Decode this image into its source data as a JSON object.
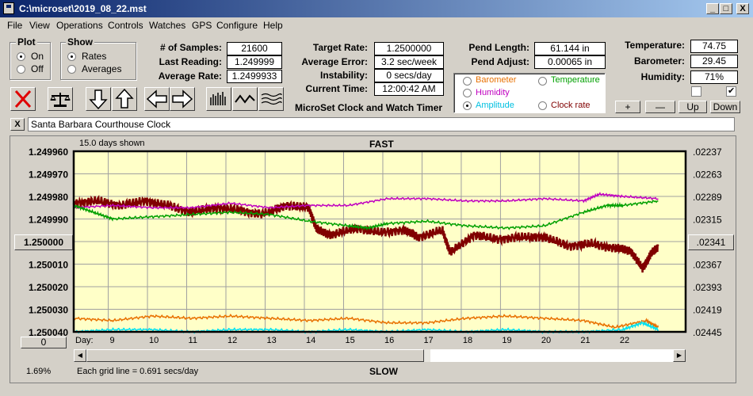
{
  "window": {
    "title": "C:\\microset\\2019_08_22.mst",
    "min": "_",
    "max": "□",
    "close": "X"
  },
  "menu": [
    "File",
    "View",
    "Operations",
    "Controls",
    "Watches",
    "GPS",
    "Configure",
    "Help"
  ],
  "plot_group": {
    "title": "Plot",
    "on": "On",
    "off": "Off",
    "selected": "On"
  },
  "show_group": {
    "title": "Show",
    "rates": "Rates",
    "averages": "Averages",
    "selected": "Rates"
  },
  "stats": {
    "samples_label": "# of Samples:",
    "samples": "21600",
    "last_label": "Last Reading:",
    "last": "1.249999",
    "avg_label": "Average Rate:",
    "avg": "1.2499933",
    "target_label": "Target Rate:",
    "target": "1.2500000",
    "err_label": "Average Error:",
    "err": "3.2 sec/week",
    "inst_label": "Instability:",
    "inst": "0 secs/day",
    "time_label": "Current Time:",
    "time": "12:00:42 AM",
    "pendlen_label": "Pend Length:",
    "pendlen": "61.144 in",
    "pendadj_label": "Pend Adjust:",
    "pendadj": "0.00065 in",
    "temp_label": "Temperature:",
    "temp": "74.75",
    "baro_label": "Barometer:",
    "baro": "29.45",
    "hum_label": "Humidity:",
    "hum": "71%"
  },
  "app_title": "MicroSet Clock and Watch Timer",
  "overlay": {
    "items": [
      {
        "label": "Barometer",
        "color": "#e87000"
      },
      {
        "label": "Temperature",
        "color": "#00a000"
      },
      {
        "label": "Humidity",
        "color": "#c000c0"
      },
      {
        "label": "Amplitude",
        "color": "#00c0e0"
      },
      {
        "label": "Clock rate",
        "color": "#800000"
      }
    ],
    "selected": "Amplitude"
  },
  "right_buttons": {
    "plus": "+",
    "minus": "—",
    "up": "Up",
    "down": "Down"
  },
  "clock_name": "Santa Barbara Courthouse Clock",
  "clock_close": "X",
  "chart_meta": {
    "days_shown": "15.0 days shown",
    "fast": "FAST",
    "slow": "SLOW",
    "grid_note": "Each grid line = 0.691 secs/day",
    "day_label": "Day:",
    "pct": "1.69%",
    "zero_btn": "0"
  },
  "chart_data": {
    "type": "line",
    "x_ticks": [
      "9",
      "10",
      "11",
      "12",
      "13",
      "14",
      "15",
      "16",
      "17",
      "18",
      "19",
      "20",
      "21",
      "22"
    ],
    "left_axis": [
      "1.249960",
      "1.249970",
      "1.249980",
      "1.249990",
      "1.250000",
      "1.250010",
      "1.250020",
      "1.250030",
      "1.250040"
    ],
    "right_axis": [
      ".02237",
      ".02263",
      ".02289",
      ".02315",
      ".02341",
      ".02367",
      ".02393",
      ".02419",
      ".02445"
    ],
    "left_center_button": "1.250000",
    "right_center_button": ".02341",
    "ylim": [
      1.24996,
      1.25004
    ],
    "xlim": [
      8.0,
      23.6
    ],
    "series": [
      {
        "name": "Clock rate",
        "color": "#800000",
        "x": [
          8.0,
          8.6,
          9.2,
          9.8,
          10.4,
          11.0,
          11.6,
          12.2,
          12.8,
          13.4,
          14.0,
          14.2,
          14.6,
          15.2,
          15.8,
          16.4,
          16.8,
          17.4,
          17.6,
          18.2,
          18.8,
          19.4,
          20.0,
          20.6,
          21.2,
          21.8,
          22.2,
          22.5,
          22.7,
          22.9
        ],
        "y": [
          1.249983,
          1.249982,
          1.249984,
          1.249982,
          1.249984,
          1.249987,
          1.249985,
          1.249986,
          1.249988,
          1.249984,
          1.249985,
          1.249995,
          1.249997,
          1.249994,
          1.249996,
          1.249995,
          1.249998,
          1.249995,
          1.250005,
          1.249997,
          1.249999,
          1.249998,
          1.249998,
          1.250002,
          1.250001,
          1.250003,
          1.250004,
          1.250012,
          1.250006,
          1.250002
        ]
      },
      {
        "name": "Humidity",
        "color": "#c000c0",
        "x": [
          8.0,
          9.0,
          10.0,
          11.0,
          12.0,
          13.0,
          14.0,
          15.0,
          16.0,
          17.0,
          18.0,
          19.0,
          20.0,
          21.0,
          21.4,
          22.0,
          22.9
        ],
        "y": [
          1.249985,
          1.249984,
          1.249985,
          1.249985,
          1.249983,
          1.249985,
          1.249984,
          1.249984,
          1.249981,
          1.249981,
          1.249982,
          1.249982,
          1.249981,
          1.249982,
          1.249979,
          1.24998,
          1.249981
        ]
      },
      {
        "name": "Temperature",
        "color": "#00a000",
        "x": [
          8.0,
          8.5,
          9.0,
          10.0,
          11.0,
          12.0,
          13.0,
          14.0,
          15.0,
          15.5,
          16.0,
          17.0,
          18.0,
          19.0,
          20.0,
          21.0,
          21.6,
          22.0,
          22.9
        ],
        "y": [
          1.249984,
          1.249987,
          1.24999,
          1.249989,
          1.249988,
          1.249987,
          1.249988,
          1.249991,
          1.249993,
          1.249994,
          1.249992,
          1.249991,
          1.249993,
          1.249994,
          1.249993,
          1.249987,
          1.249984,
          1.249984,
          1.249982
        ]
      },
      {
        "name": "Barometer",
        "color": "#e87000",
        "x": [
          8.0,
          9.0,
          10.0,
          11.0,
          12.0,
          13.0,
          14.0,
          15.0,
          16.0,
          17.0,
          18.0,
          19.0,
          20.0,
          21.0,
          21.8,
          22.6,
          22.9
        ],
        "y": [
          1.250034,
          1.250035,
          1.250033,
          1.250034,
          1.250033,
          1.250034,
          1.250035,
          1.250034,
          1.250036,
          1.250036,
          1.250034,
          1.250033,
          1.250034,
          1.250035,
          1.250038,
          1.250035,
          1.250038
        ]
      },
      {
        "name": "Amplitude",
        "color": "#00e0f0",
        "x": [
          8.0,
          9.0,
          10.0,
          11.0,
          12.0,
          13.0,
          14.0,
          15.0,
          16.0,
          17.0,
          18.0,
          19.0,
          20.0,
          21.0,
          22.0,
          22.5,
          22.9
        ],
        "y": [
          1.25004,
          1.250039,
          1.250039,
          1.25004,
          1.250039,
          1.250039,
          1.25004,
          1.250039,
          1.25004,
          1.250039,
          1.25004,
          1.250039,
          1.25004,
          1.25004,
          1.250039,
          1.250036,
          1.250039
        ]
      }
    ],
    "grid": true
  }
}
